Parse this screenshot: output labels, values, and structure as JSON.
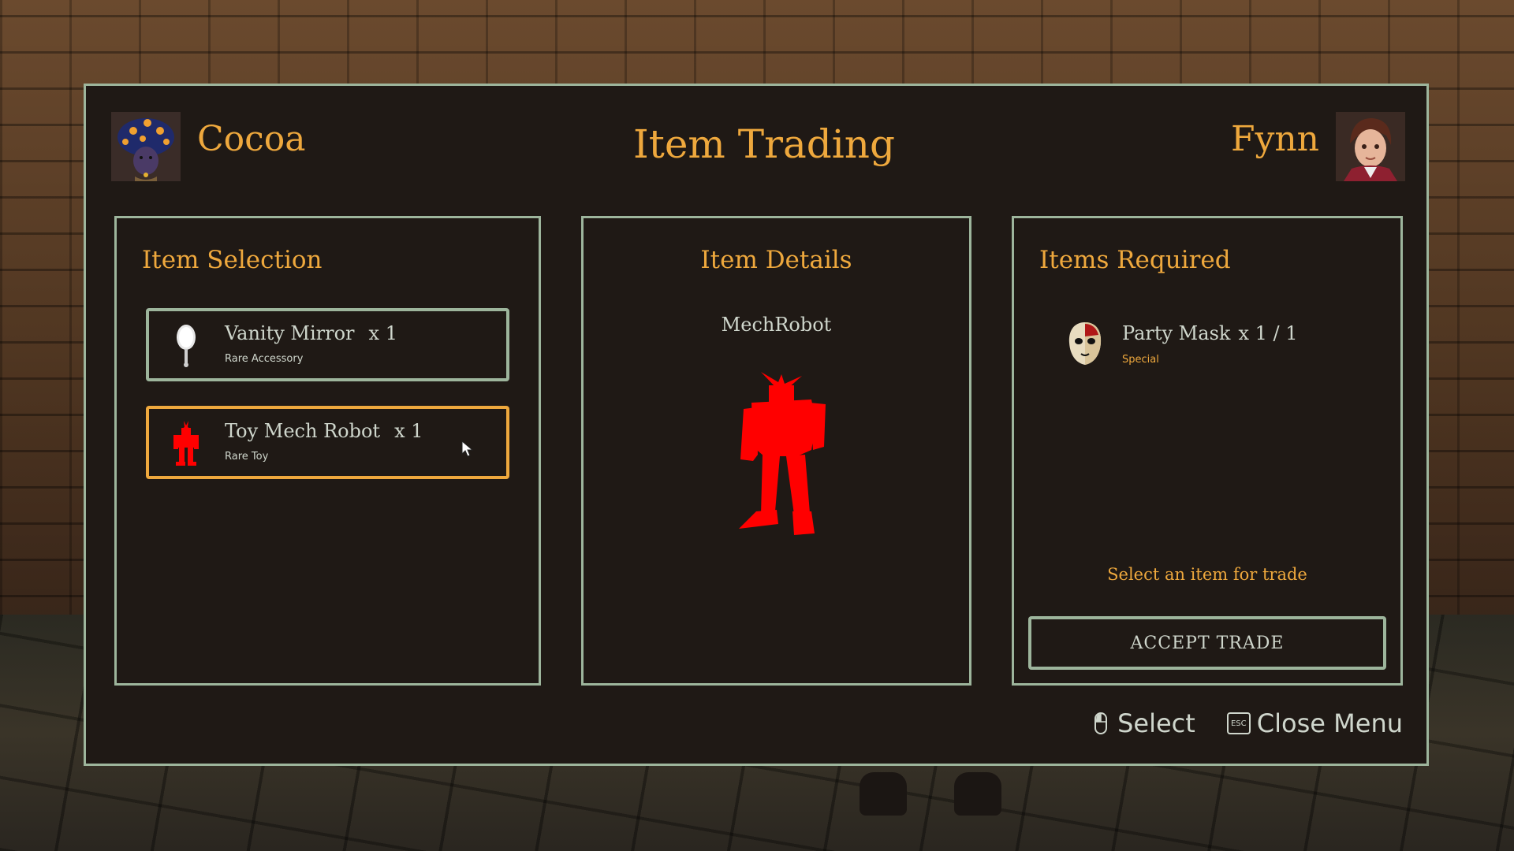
{
  "header": {
    "title": "Item Trading",
    "left_player": {
      "name": "Cocoa",
      "avatar_icon": "mushroom-hat-character-avatar"
    },
    "right_player": {
      "name": "Fynn",
      "avatar_icon": "brown-haired-boy-avatar"
    }
  },
  "selection": {
    "title": "Item Selection",
    "items": [
      {
        "name": "Vanity Mirror",
        "qty": "x 1",
        "rarity": "Rare Accessory",
        "icon": "hand-mirror-icon",
        "selected": false
      },
      {
        "name": "Toy Mech Robot",
        "qty": "x 1",
        "rarity": "Rare Toy",
        "icon": "mech-robot-icon",
        "selected": true
      }
    ]
  },
  "details": {
    "title": "Item Details",
    "item_name": "MechRobot",
    "icon": "mech-robot-icon",
    "icon_color": "#ff0000"
  },
  "required": {
    "title": "Items Required",
    "items": [
      {
        "name": "Party Mask",
        "qty": "x 1 / 1",
        "rarity": "Special",
        "icon": "party-mask-icon"
      }
    ],
    "hint": "Select an item for trade",
    "accept_label": "ACCEPT TRADE"
  },
  "footer": {
    "select_label": "Select",
    "select_icon": "mouse-icon",
    "close_label": "Close Menu",
    "close_key": "ESC"
  },
  "colors": {
    "accent": "#eea83d",
    "border": "#9db59c",
    "panel_bg": "#1f1915",
    "text": "#cfd6cc"
  }
}
